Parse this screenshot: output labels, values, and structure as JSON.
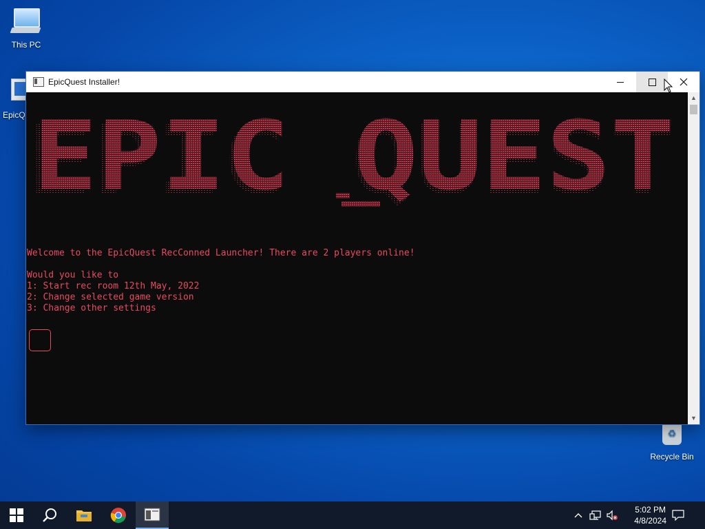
{
  "desktop": {
    "icons": [
      {
        "label": "This PC"
      },
      {
        "label": "EpicQu"
      },
      {
        "label": "Recycle Bin"
      }
    ]
  },
  "window": {
    "title": "EpicQuest Installer!",
    "banner_text": "EPIC QUEST",
    "console_lines": [
      "Welcome to the EpicQuest RecConned Launcher! There are 2 players online!",
      "",
      "Would you like to",
      "1: Start rec room 12th May, 2022",
      "2: Change selected game version",
      "3: Change other settings"
    ],
    "accent_color": "#e84a5f"
  },
  "taskbar": {
    "items": [
      "windows-start-icon",
      "search-icon",
      "file-explorer-icon",
      "chrome-icon",
      "epicquest-terminal-icon"
    ],
    "clock": {
      "time": "5:02 PM",
      "date": "4/8/2024"
    }
  }
}
